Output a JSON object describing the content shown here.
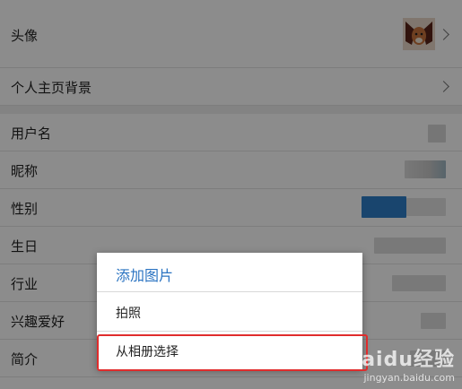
{
  "profile": {
    "rows": [
      {
        "label": "头像"
      },
      {
        "label": "个人主页背景"
      },
      {
        "label": "用户名"
      },
      {
        "label": "昵称"
      },
      {
        "label": "性别"
      },
      {
        "label": "生日"
      },
      {
        "label": "行业"
      },
      {
        "label": "兴趣爱好"
      },
      {
        "label": "简介"
      }
    ]
  },
  "dialog": {
    "title": "添加图片",
    "options": [
      {
        "label": "拍照"
      },
      {
        "label": "从相册选择"
      }
    ]
  },
  "watermark": {
    "brand": "Baidu经验",
    "url": "jingyan.baidu.com"
  },
  "colors": {
    "dialog_title": "#2b74c2",
    "highlight_border": "#e02c2c",
    "gender_value": "#2f7fc8"
  }
}
